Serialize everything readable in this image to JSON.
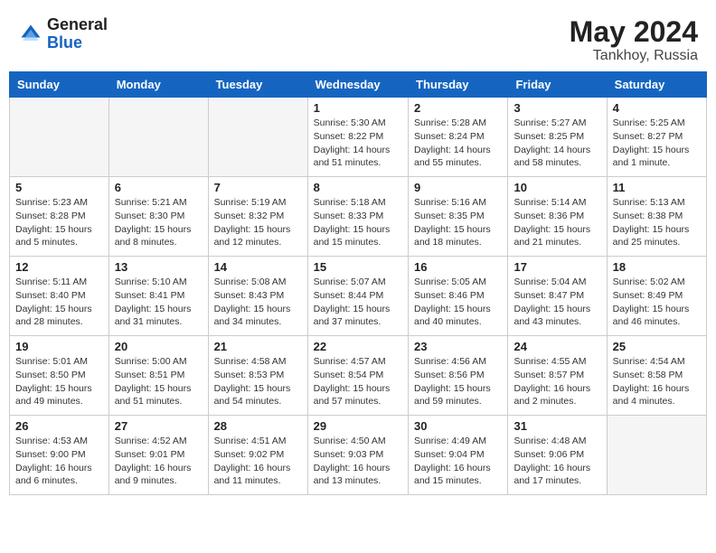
{
  "header": {
    "logo_general": "General",
    "logo_blue": "Blue",
    "month_year": "May 2024",
    "location": "Tankhoy, Russia"
  },
  "weekdays": [
    "Sunday",
    "Monday",
    "Tuesday",
    "Wednesday",
    "Thursday",
    "Friday",
    "Saturday"
  ],
  "weeks": [
    [
      {
        "day": "",
        "info": ""
      },
      {
        "day": "",
        "info": ""
      },
      {
        "day": "",
        "info": ""
      },
      {
        "day": "1",
        "info": "Sunrise: 5:30 AM\nSunset: 8:22 PM\nDaylight: 14 hours\nand 51 minutes."
      },
      {
        "day": "2",
        "info": "Sunrise: 5:28 AM\nSunset: 8:24 PM\nDaylight: 14 hours\nand 55 minutes."
      },
      {
        "day": "3",
        "info": "Sunrise: 5:27 AM\nSunset: 8:25 PM\nDaylight: 14 hours\nand 58 minutes."
      },
      {
        "day": "4",
        "info": "Sunrise: 5:25 AM\nSunset: 8:27 PM\nDaylight: 15 hours\nand 1 minute."
      }
    ],
    [
      {
        "day": "5",
        "info": "Sunrise: 5:23 AM\nSunset: 8:28 PM\nDaylight: 15 hours\nand 5 minutes."
      },
      {
        "day": "6",
        "info": "Sunrise: 5:21 AM\nSunset: 8:30 PM\nDaylight: 15 hours\nand 8 minutes."
      },
      {
        "day": "7",
        "info": "Sunrise: 5:19 AM\nSunset: 8:32 PM\nDaylight: 15 hours\nand 12 minutes."
      },
      {
        "day": "8",
        "info": "Sunrise: 5:18 AM\nSunset: 8:33 PM\nDaylight: 15 hours\nand 15 minutes."
      },
      {
        "day": "9",
        "info": "Sunrise: 5:16 AM\nSunset: 8:35 PM\nDaylight: 15 hours\nand 18 minutes."
      },
      {
        "day": "10",
        "info": "Sunrise: 5:14 AM\nSunset: 8:36 PM\nDaylight: 15 hours\nand 21 minutes."
      },
      {
        "day": "11",
        "info": "Sunrise: 5:13 AM\nSunset: 8:38 PM\nDaylight: 15 hours\nand 25 minutes."
      }
    ],
    [
      {
        "day": "12",
        "info": "Sunrise: 5:11 AM\nSunset: 8:40 PM\nDaylight: 15 hours\nand 28 minutes."
      },
      {
        "day": "13",
        "info": "Sunrise: 5:10 AM\nSunset: 8:41 PM\nDaylight: 15 hours\nand 31 minutes."
      },
      {
        "day": "14",
        "info": "Sunrise: 5:08 AM\nSunset: 8:43 PM\nDaylight: 15 hours\nand 34 minutes."
      },
      {
        "day": "15",
        "info": "Sunrise: 5:07 AM\nSunset: 8:44 PM\nDaylight: 15 hours\nand 37 minutes."
      },
      {
        "day": "16",
        "info": "Sunrise: 5:05 AM\nSunset: 8:46 PM\nDaylight: 15 hours\nand 40 minutes."
      },
      {
        "day": "17",
        "info": "Sunrise: 5:04 AM\nSunset: 8:47 PM\nDaylight: 15 hours\nand 43 minutes."
      },
      {
        "day": "18",
        "info": "Sunrise: 5:02 AM\nSunset: 8:49 PM\nDaylight: 15 hours\nand 46 minutes."
      }
    ],
    [
      {
        "day": "19",
        "info": "Sunrise: 5:01 AM\nSunset: 8:50 PM\nDaylight: 15 hours\nand 49 minutes."
      },
      {
        "day": "20",
        "info": "Sunrise: 5:00 AM\nSunset: 8:51 PM\nDaylight: 15 hours\nand 51 minutes."
      },
      {
        "day": "21",
        "info": "Sunrise: 4:58 AM\nSunset: 8:53 PM\nDaylight: 15 hours\nand 54 minutes."
      },
      {
        "day": "22",
        "info": "Sunrise: 4:57 AM\nSunset: 8:54 PM\nDaylight: 15 hours\nand 57 minutes."
      },
      {
        "day": "23",
        "info": "Sunrise: 4:56 AM\nSunset: 8:56 PM\nDaylight: 15 hours\nand 59 minutes."
      },
      {
        "day": "24",
        "info": "Sunrise: 4:55 AM\nSunset: 8:57 PM\nDaylight: 16 hours\nand 2 minutes."
      },
      {
        "day": "25",
        "info": "Sunrise: 4:54 AM\nSunset: 8:58 PM\nDaylight: 16 hours\nand 4 minutes."
      }
    ],
    [
      {
        "day": "26",
        "info": "Sunrise: 4:53 AM\nSunset: 9:00 PM\nDaylight: 16 hours\nand 6 minutes."
      },
      {
        "day": "27",
        "info": "Sunrise: 4:52 AM\nSunset: 9:01 PM\nDaylight: 16 hours\nand 9 minutes."
      },
      {
        "day": "28",
        "info": "Sunrise: 4:51 AM\nSunset: 9:02 PM\nDaylight: 16 hours\nand 11 minutes."
      },
      {
        "day": "29",
        "info": "Sunrise: 4:50 AM\nSunset: 9:03 PM\nDaylight: 16 hours\nand 13 minutes."
      },
      {
        "day": "30",
        "info": "Sunrise: 4:49 AM\nSunset: 9:04 PM\nDaylight: 16 hours\nand 15 minutes."
      },
      {
        "day": "31",
        "info": "Sunrise: 4:48 AM\nSunset: 9:06 PM\nDaylight: 16 hours\nand 17 minutes."
      },
      {
        "day": "",
        "info": ""
      }
    ]
  ]
}
